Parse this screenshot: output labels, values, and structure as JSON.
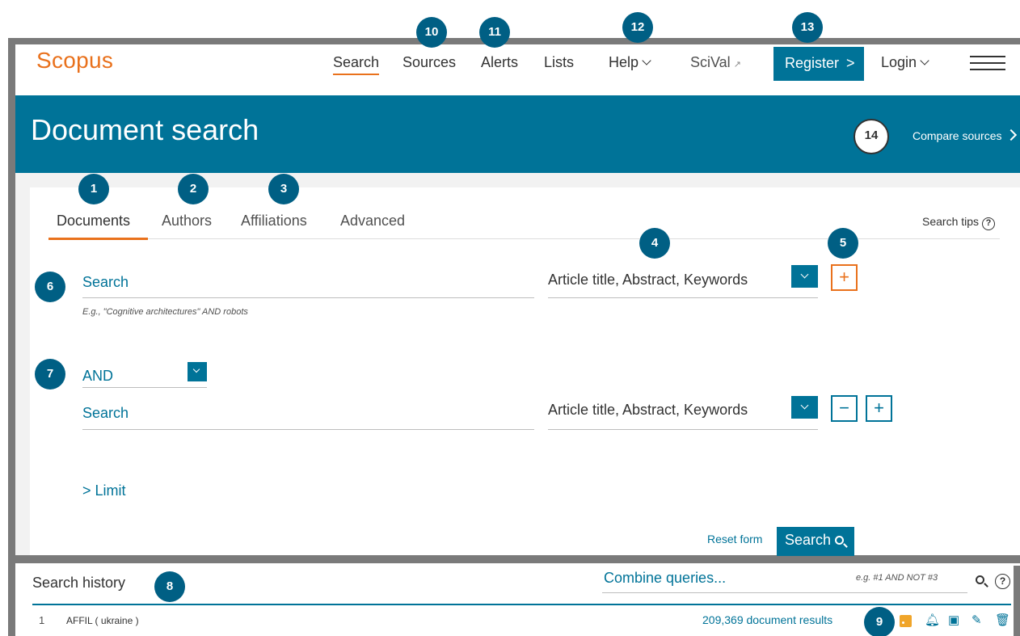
{
  "header": {
    "logo": "Scopus",
    "nav": {
      "search": "Search",
      "sources": "Sources",
      "alerts": "Alerts",
      "lists": "Lists",
      "help": "Help",
      "scival": "SciVal",
      "register": "Register",
      "login": "Login"
    }
  },
  "banner": {
    "title": "Document search",
    "compare": "Compare sources"
  },
  "tabs": {
    "documents": "Documents",
    "authors": "Authors",
    "affiliations": "Affiliations",
    "advanced": "Advanced",
    "search_tips": "Search tips"
  },
  "form": {
    "row1": {
      "placeholder": "Search",
      "field": "Article title, Abstract, Keywords",
      "hint": "E.g., \"Cognitive architectures\" AND robots",
      "add": "+"
    },
    "row2": {
      "operator": "AND",
      "placeholder": "Search",
      "field": "Article title, Abstract, Keywords",
      "remove": "−",
      "add": "+"
    },
    "limit": "Limit",
    "reset": "Reset form",
    "search": "Search"
  },
  "history": {
    "title": "Search history",
    "combine_placeholder": "Combine queries...",
    "combine_hint": "e.g. #1 AND NOT #3",
    "rows": [
      {
        "num": "1",
        "query": "AFFIL ( ukraine )",
        "results": "209,369 document results"
      }
    ]
  },
  "callouts": {
    "c1": "1",
    "c2": "2",
    "c3": "3",
    "c4": "4",
    "c5": "5",
    "c6": "6",
    "c7": "7",
    "c8": "8",
    "c9": "9",
    "c10": "10",
    "c11": "11",
    "c12": "12",
    "c13": "13",
    "c14": "14"
  },
  "colors": {
    "brand": "#007398",
    "accent": "#e9711c",
    "callout": "#005f84",
    "frame": "#7a7a7a"
  }
}
